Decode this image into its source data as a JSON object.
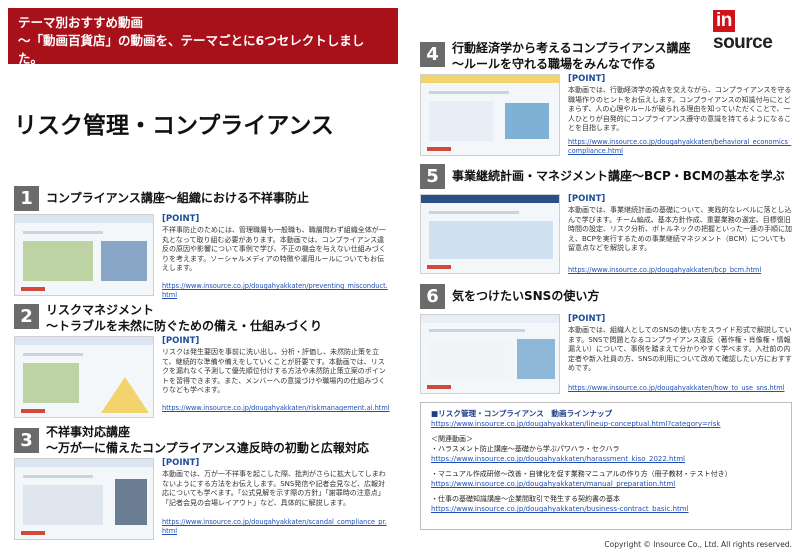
{
  "header": {
    "line1": "テーマ別おすすめ動画",
    "line2": "～「動画百貨店」の動画を、テーマごとに6つセレクトしました。"
  },
  "logo": {
    "prefix": "in",
    "suffix": "source"
  },
  "main_title": "リスク管理・コンプライアンス",
  "sections": [
    {
      "num": "1",
      "title_l1": "コンプライアンス講座～組織における不祥事防止",
      "title_l2": "",
      "point": "[POINT]",
      "desc": "不祥事防止のためには、管理職層も一般職も、職層問わず組織全体が一丸となって取り組む必要があります。本動画では、コンプライアンス違反の原因や影響について事例で学び、不正の機会を与えない仕組みづくりを考えます。ソーシャルメディアの特徴や運用ルールについてもお伝えします。",
      "link": "https://www.insource.co.jp/dougahyakkaten/preventing_misconduct.html"
    },
    {
      "num": "2",
      "title_l1": "リスクマネジメント",
      "title_l2": "～トラブルを未然に防ぐための備え・仕組みづくり",
      "point": "[POINT]",
      "desc": "リスクは発生要因を事前に洗い出し、分析・評価し、未然防止策を立て、継続的な準備や備えをしていくことが肝要です。本動画では、リスクを漏れなく予測して優先順位付けする方法や未然防止策立案のポイントを習得できます。また、メンバーへの意識づけや職場内の仕組みづくりなども学べます。",
      "link": "https://www.insource.co.jp/dougahyakkaten/riskmanagement.ai.html"
    },
    {
      "num": "3",
      "title_l1": "不祥事対応講座",
      "title_l2": "～万が一に備えたコンプライアンス違反時の初動と広報対応",
      "point": "[POINT]",
      "desc": "本動画では、万が一不祥事を起こした際、批判がさらに拡大してしまわないようにする方法をお伝えします。SNS発信や記者会見など、広報対応についても学べます。「公式見解を示す際の方針」「謝罪時の注意点」「記者会見の会場レイアウト」など、具体的に解説します。",
      "link": "https://www.insource.co.jp/dougahyakkaten/scandal_compliance_pr.html"
    },
    {
      "num": "4",
      "title_l1": "行動経済学から考えるコンプライアンス講座",
      "title_l2": "～ルールを守れる職場をみんなで作る",
      "point": "[POINT]",
      "desc": "本動画では、行動経済学の視点を交えながら、コンプライアンスを守る職場作りのヒントをお伝えします。コンプライアンスの知識付与にとどまらず、人の心理やルールが破られる理由を知っていただくことで、一人ひとりが自発的にコンプライアンス遵守の意識を持てるようになることを目指します。",
      "link": "https://www.insource.co.jp/dougahyakkaten/behavioral_economics_compliance.html"
    },
    {
      "num": "5",
      "title_l1": "事業継続計画・マネジメント講座～BCP・BCMの基本を学ぶ",
      "title_l2": "",
      "point": "[POINT]",
      "desc": "本動画では、事業継続計画の基礎について、実践的なレベルに落とし込んで学びます。チーム編成、基本方針作成、重要業務の選定、目標復旧時間の設定、リスク分析、ボトルネックの把握といった一連の手順に加え、BCPを実行するための事業継続マネジメント（BCM）についても留意点などを解説します。",
      "link": "https://www.insource.co.jp/dougahyakkaten/bcp_bcm.html"
    },
    {
      "num": "6",
      "title_l1": "気をつけたいSNSの使い方",
      "title_l2": "",
      "point": "[POINT]",
      "desc": "本動画では、組織人としてのSNSの使い方をスライド形式で解説しています。SNSで問題となるコンプライアンス違反（著作権・肖像権・情報漏えい）について、事例を踏まえて分かりやすく学べます。入社前の内定者や新入社員の方、SNSの利用について改めて確認したい方におすすめです。",
      "link": "https://www.insource.co.jp/dougahyakkaten/how_to_use_sns.html"
    }
  ],
  "lineup": {
    "heading": "■リスク管理・コンプライアンス　動画ラインナップ",
    "heading_link": "https://www.insource.co.jp/dougahyakkaten/lineup-conceptual.html?category=risk",
    "related_label": "＜関連動画＞",
    "items": [
      {
        "label": "・ハラスメント防止講座～基礎から学ぶパワハラ・セクハラ",
        "link": "https://www.insource.co.jp/dougahyakkaten/harassment_kiso_2022.html"
      },
      {
        "label": "・マニュアル作成研修～改善・自律化を促す業務マニュアルの作り方（冊子教材・テスト付き）",
        "link": "https://www.insource.co.jp/dougahyakkaten/manual_preparation.html"
      },
      {
        "label": "・仕事の基礎知識講座～企業間取引で発生する契約書の基本",
        "link": "https://www.insource.co.jp/dougahyakkaten/business-contract_basic.html"
      }
    ]
  },
  "copyright": "Copyright © Insource Co., Ltd. All rights reserved.",
  "colors": {
    "banner": "#a8101a",
    "accent_yellow": "#f6e35a",
    "link": "#1f4fb8",
    "point": "#1b4b9a",
    "num_bg": "#6b6b6b"
  }
}
